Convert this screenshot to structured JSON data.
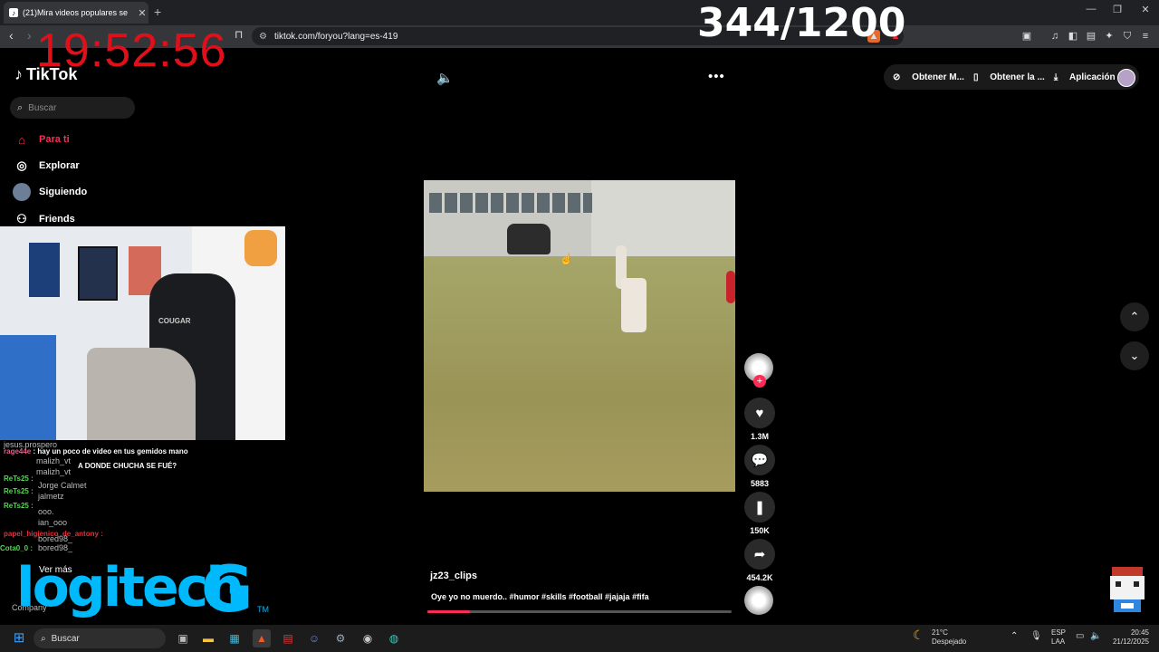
{
  "browser": {
    "tab_title": "(21)Mira videos populares se",
    "url": "tiktok.com/foryou?lang=es-419"
  },
  "overlay": {
    "clock": "19:52:56",
    "counter": "344/1200"
  },
  "tiktok": {
    "logo_text": "TikTok",
    "search_placeholder": "Buscar",
    "nav": [
      {
        "label": "Para ti"
      },
      {
        "label": "Explorar"
      },
      {
        "label": "Siguiendo"
      },
      {
        "label": "Friends"
      }
    ],
    "top_actions": [
      "Obtener M...",
      "Obtener la ...",
      "Aplicación ..."
    ],
    "video": {
      "author": "jz23_clips",
      "description": "Oye yo no muerdo.. #humor #skills #football #jajaja #fifa",
      "progress": 0.14
    },
    "stats": {
      "likes": "1.3M",
      "comments": "5883",
      "saves": "150K",
      "shares": "454.2K"
    }
  },
  "chat": [
    {
      "user": "",
      "msg": "jesus.prospero"
    },
    {
      "user": "rage44e",
      "msg": "hay un poco de video en tus gemidos mano"
    },
    {
      "user": "",
      "msg": "malizh_vt"
    },
    {
      "user": "",
      "msg": "A DONDE CHUCHA SE FUÉ?"
    },
    {
      "user": "",
      "msg": "malizh_vt"
    },
    {
      "user": "ReTs25 :",
      "msg": "Jorge Calmet"
    },
    {
      "user": "ReTs25 :",
      "msg": "jalmetz"
    },
    {
      "user": "ReTs25 :",
      "msg": "ooo."
    },
    {
      "user": "",
      "msg": "ian_ooo"
    },
    {
      "user": "papel_higienico_de_antony :",
      "msg": ""
    },
    {
      "user": "",
      "msg": "bored98_"
    },
    {
      "user": "Cota0_0 :",
      "msg": "bored98_"
    }
  ],
  "stream": {
    "ver_mas": "Ver más",
    "company": "Company",
    "sponsor": "logitech",
    "sponsor_mark": "G",
    "tm": "TM"
  },
  "taskbar": {
    "search": "Buscar",
    "weather_temp": "21°C",
    "weather_desc": "Despejado",
    "lang1": "ESP",
    "lang2": "LAA",
    "time": "20:45",
    "date": "21/12/2025"
  }
}
